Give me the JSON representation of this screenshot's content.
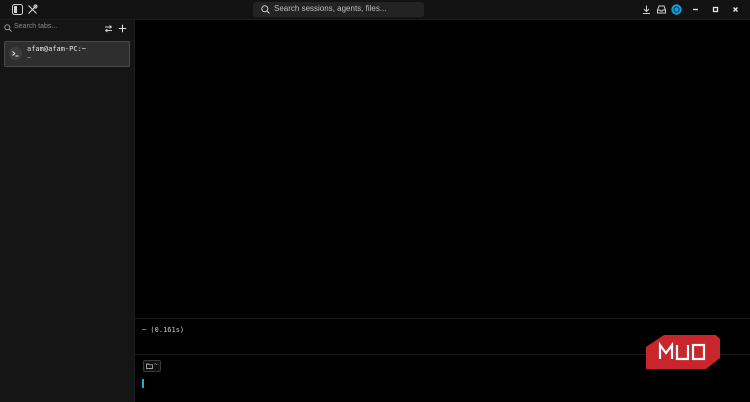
{
  "titlebar": {
    "search_placeholder": "Search sessions, agents, files...",
    "icons": [
      "sidebar-toggle-icon",
      "tools-icon",
      "download-icon",
      "inbox-icon",
      "avatar",
      "minimize-icon",
      "maximize-icon",
      "close-icon"
    ],
    "accent_color": "#1a9bd8"
  },
  "sidebar": {
    "search_placeholder": "Search tabs...",
    "sessions": [
      {
        "title": "afam@afam-PC:~",
        "subtitle": "~"
      }
    ]
  },
  "terminal": {
    "block_output": "~ (0.161s)",
    "cwd_label": "~",
    "cursor_color": "#23a7e0"
  },
  "watermark": {
    "text": "MUO",
    "color": "#c8252c"
  }
}
